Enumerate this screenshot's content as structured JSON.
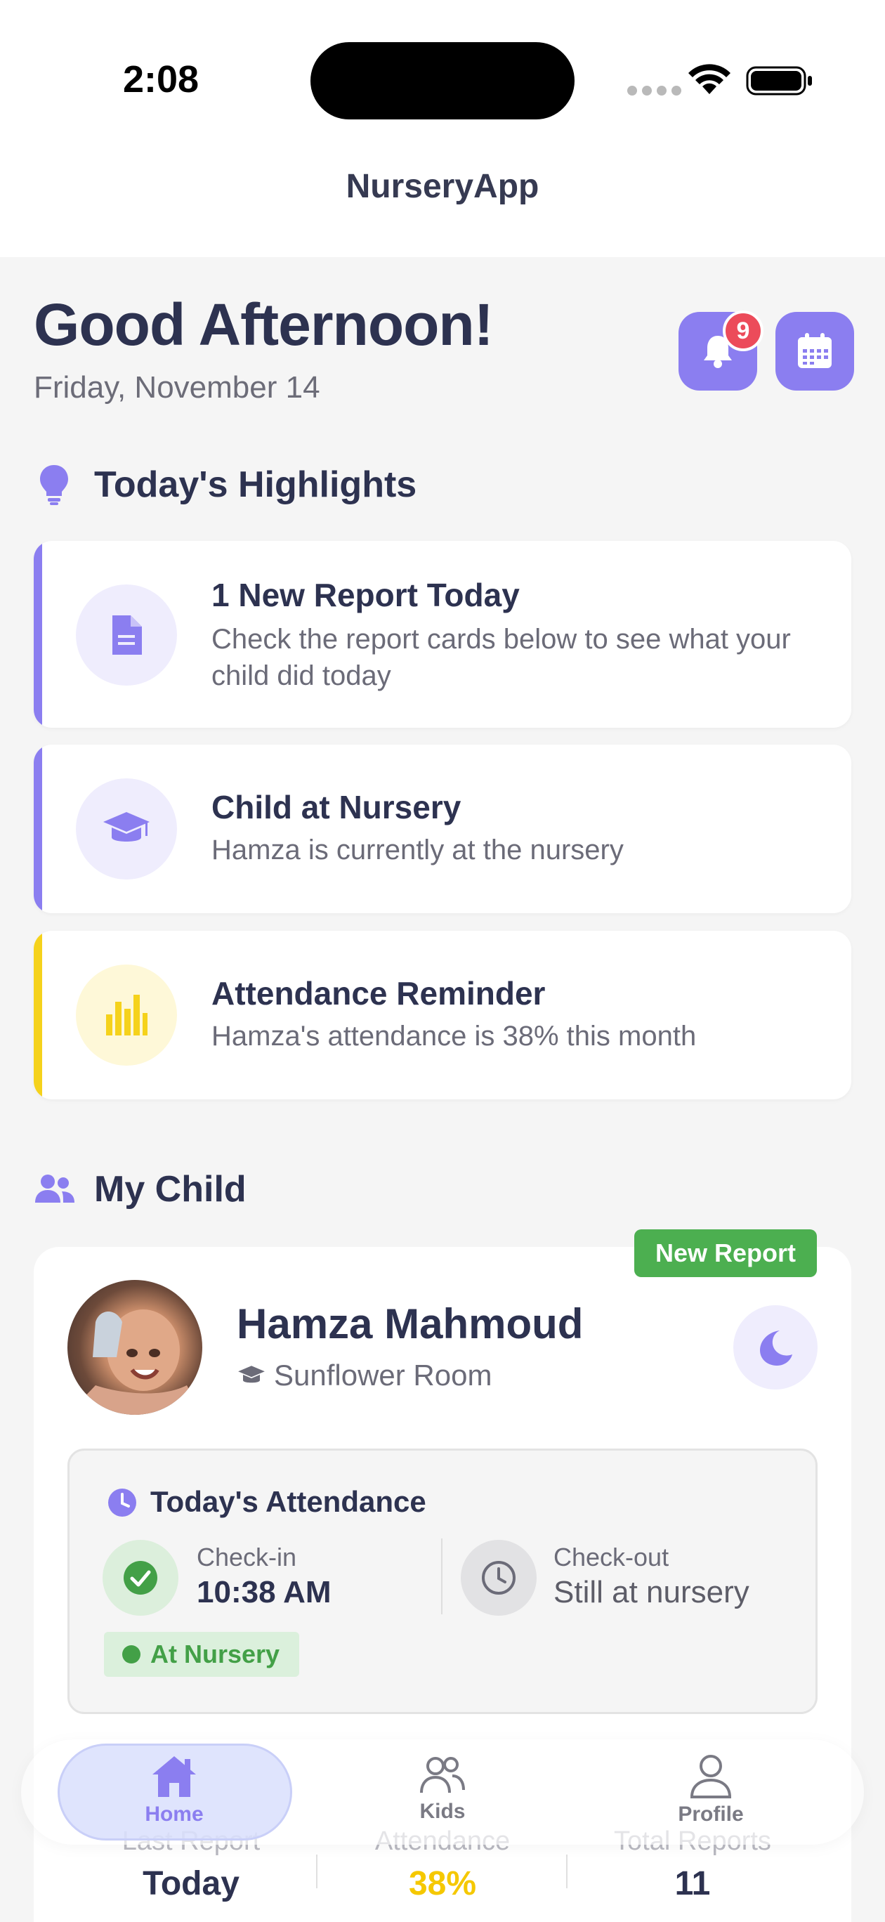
{
  "status_bar": {
    "time": "2:08"
  },
  "app": {
    "title": "NurseryApp"
  },
  "header": {
    "greeting": "Good Afternoon!",
    "date": "Friday, November 14",
    "notification_count": "9"
  },
  "highlights": {
    "title": "Today's Highlights",
    "items": [
      {
        "title": "1 New Report Today",
        "description": "Check the report cards below to see what your child did today",
        "icon": "document-icon",
        "accent": "#8b7ef0"
      },
      {
        "title": "Child at Nursery",
        "description": "Hamza is currently at the nursery",
        "icon": "graduation-cap-icon",
        "accent": "#8b7ef0"
      },
      {
        "title": "Attendance Reminder",
        "description": "Hamza's attendance is 38% this month",
        "icon": "bar-chart-icon",
        "accent": "#f5d21c"
      }
    ]
  },
  "my_child": {
    "title": "My Child",
    "badge": "New Report",
    "name": "Hamza Mahmoud",
    "room": "Sunflower Room",
    "attendance": {
      "title": "Today's Attendance",
      "checkin_label": "Check-in",
      "checkin_value": "10:38 AM",
      "checkout_label": "Check-out",
      "checkout_value": "Still at nursery",
      "status": "At Nursery"
    },
    "stats": [
      {
        "label": "Last Report",
        "value": "Today"
      },
      {
        "label": "Attendance",
        "value": "38%"
      },
      {
        "label": "Total Reports",
        "value": "11"
      }
    ]
  },
  "tabs": [
    {
      "label": "Home",
      "active": true
    },
    {
      "label": "Kids",
      "active": false
    },
    {
      "label": "Profile",
      "active": false
    }
  ],
  "colors": {
    "accent": "#8b7ef0",
    "warning": "#f5d21c",
    "success": "#4caf50",
    "badge": "#ec4b5a"
  }
}
